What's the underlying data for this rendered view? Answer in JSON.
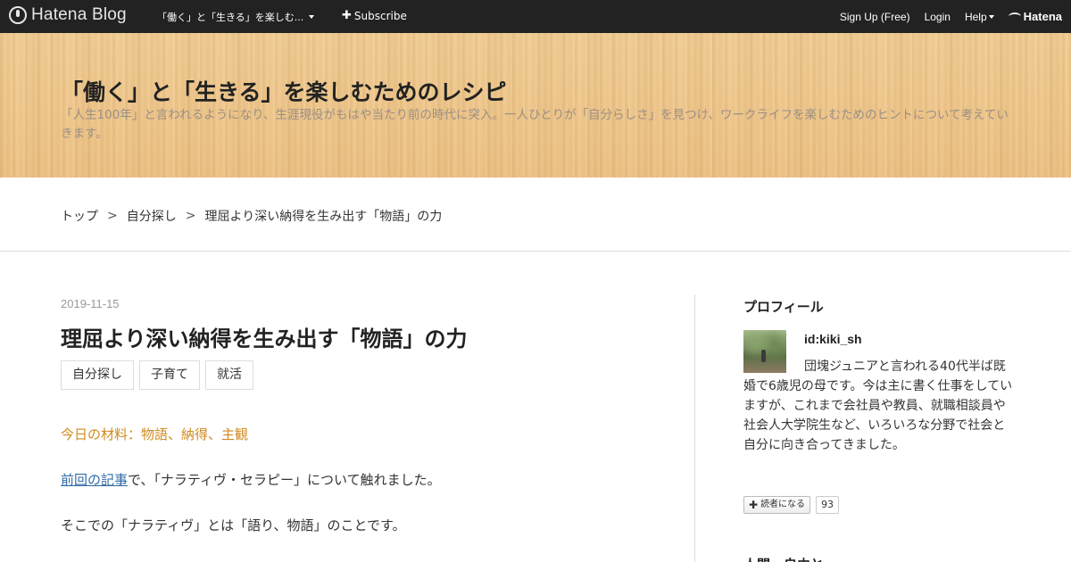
{
  "navbar": {
    "logo_text": "Hatena Blog",
    "blog_name": "「働く」と「生きる」を楽しむ...",
    "subscribe_label": "Subscribe",
    "signup_label": "Sign Up (Free)",
    "login_label": "Login",
    "help_label": "Help",
    "brand_label": "Hatena"
  },
  "header": {
    "title": "「働く」と「生きる」を楽しむためのレシピ",
    "description": "「人生100年」と言われるようになり、生涯現役がもはや当たり前の時代に突入。一人ひとりが「自分らしさ」を見つけ、ワークライフを楽しむためのヒントについて考えていきます。"
  },
  "breadcrumb": {
    "items": [
      "トップ",
      "自分探し",
      "理屈より深い納得を生み出す「物語」の力"
    ],
    "separator": ">"
  },
  "article": {
    "date": "2019-11-15",
    "title": "理屈より深い納得を生み出す「物語」の力",
    "tags": [
      "自分探し",
      "子育て",
      "就活"
    ],
    "materials": "今日の材料：物語、納得、主観",
    "para2_link": "前回の記事",
    "para2_rest": "で、「ナラティヴ・セラピー」について触れました。",
    "para3": "そこでの「ナラティヴ」とは「語り、物語」のことです。"
  },
  "sidebar": {
    "profile_heading": "プロフィール",
    "profile_id": "id:kiki_sh",
    "bio": "団塊ジュニアと言われる40代半ば既婚で6歳児の母です。今は主に書く仕事をしていますが、これまで会社員や教員、就職相談員や社会人大学院生など、いろいろな分野で社会と自分に向き合ってきました。",
    "follow_label": "読者になる",
    "follow_count": "93",
    "next_heading": "人間・自由と"
  }
}
